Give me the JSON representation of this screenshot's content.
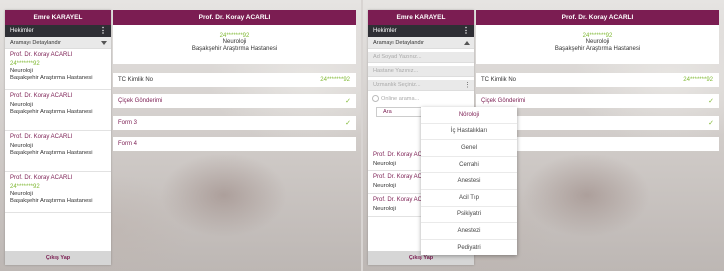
{
  "user_name": "Emre KARAYEL",
  "doctor_header": "Prof. Dr. Koray ACARLI",
  "sidebar": {
    "section_label": "Hekimler",
    "filter_label": "Aramayı Detaylandır",
    "logout_label": "Çıkış Yap",
    "doctors": [
      {
        "name": "Prof. Dr. Koray ACARLI",
        "phone": "24*******92",
        "dept": "Neuroloji",
        "hospital": "Başakşehir Araştırma Hastanesi"
      },
      {
        "name": "Prof. Dr. Koray ACARLI",
        "phone": "",
        "dept": "Neuroloji",
        "hospital": "Başakşehir Araştırma Hastanesi"
      },
      {
        "name": "Prof. Dr. Koray ACARLI",
        "phone": "",
        "dept": "Neuroloji",
        "hospital": "Başakşehir Araştırma Hastanesi"
      },
      {
        "name": "Prof. Dr. Koray ACARLI",
        "phone": "24*******92",
        "dept": "Neuroloji",
        "hospital": "Başakşehir Araştırma Hastanesi"
      }
    ]
  },
  "detail": {
    "phone": "24*******92",
    "dept": "Neuroloji",
    "hospital": "Başakşehir Araştırma Hastanesi",
    "tc_label": "TC Kimlik No",
    "tc_value": "24*******92",
    "rows": [
      "Çiçek Gönderimi",
      "Form 3",
      "Form 4"
    ]
  },
  "filter_form": {
    "name_placeholder": "Ad Soyad Yazınız...",
    "hospital_placeholder": "Hastane Yazınız...",
    "specialty_placeholder": "Uzmanlık Seçiniz...",
    "online_label": "Online arama...",
    "search_label": "Ara"
  },
  "specialties": [
    "Nöroloji",
    "İç Hastalıkları",
    "Genel",
    "Cerrahi",
    "Anestesi",
    "Acil Tıp",
    "Psikiyatri",
    "Anestezi",
    "Pediyatri"
  ],
  "colors": {
    "brand": "#7b1d52",
    "accent_green": "#7fb832",
    "dark_bar": "#2f2f35"
  }
}
